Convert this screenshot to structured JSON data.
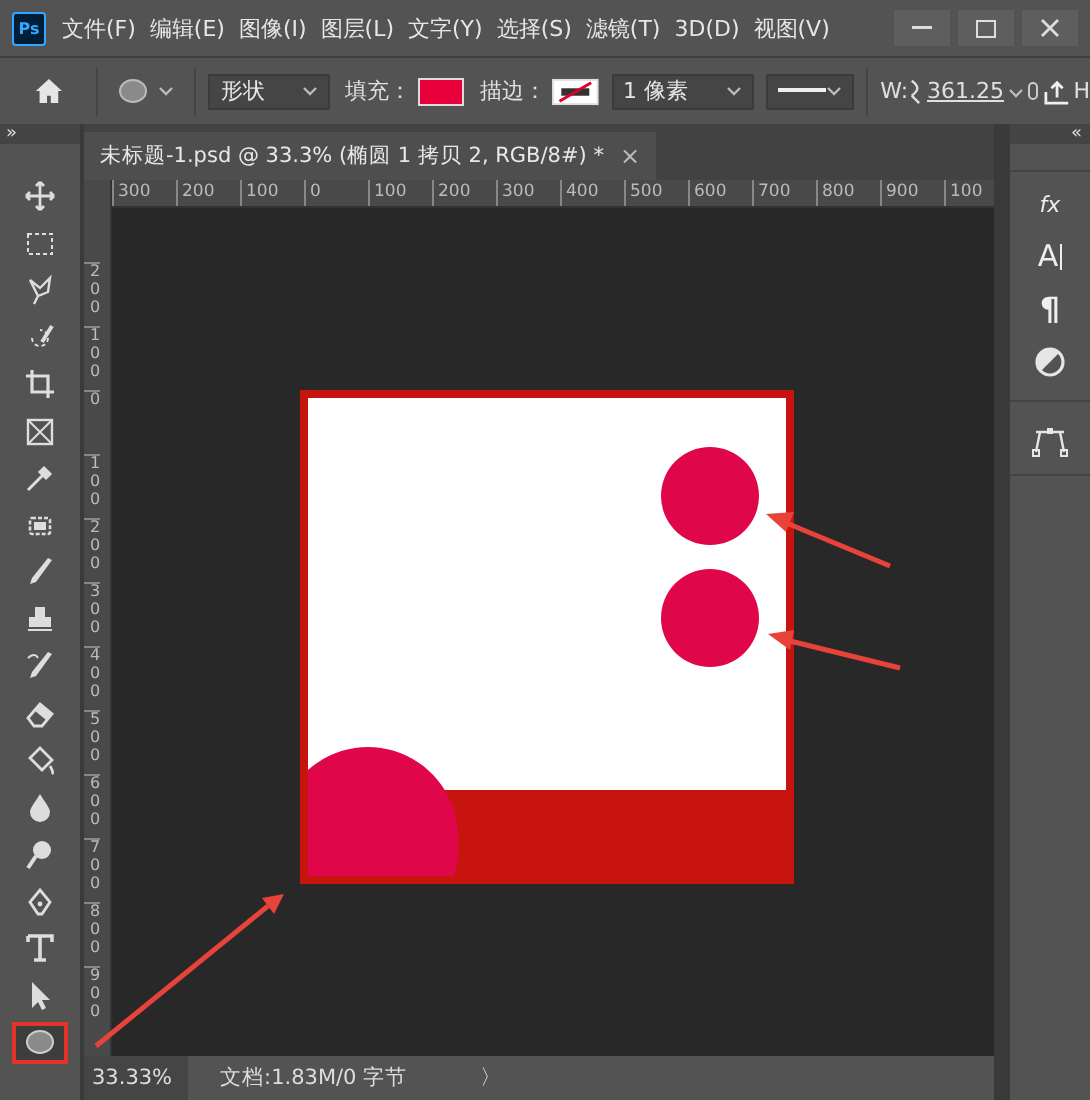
{
  "app_logo": "Ps",
  "menu": [
    "文件(F)",
    "编辑(E)",
    "图像(I)",
    "图层(L)",
    "文字(Y)",
    "选择(S)",
    "滤镜(T)",
    "3D(D)",
    "视图(V)"
  ],
  "options_bar": {
    "shape_mode": "形状",
    "fill_label": "填充：",
    "stroke_label": "描边：",
    "stroke_width": "1 像素",
    "width_label": "W:",
    "width_value": "361.25",
    "height_label": "H"
  },
  "left_panel_toggle": "»",
  "right_panel_toggle": "«",
  "document_tab": {
    "title": "未标题-1.psd @ 33.3% (椭圆 1 拷贝 2, RGB/8#) *",
    "close": "×"
  },
  "ruler_horizontal": [
    "300",
    "200",
    "100",
    "0",
    "100",
    "200",
    "300",
    "400",
    "500",
    "600",
    "700",
    "800",
    "900",
    "100"
  ],
  "ruler_vertical": [
    "200",
    "100",
    "0",
    "100",
    "200",
    "300",
    "400",
    "500",
    "600",
    "700",
    "800",
    "900"
  ],
  "tools": [
    {
      "kind": "move",
      "selected": false
    },
    {
      "kind": "marquee",
      "selected": false
    },
    {
      "kind": "lasso",
      "selected": false
    },
    {
      "kind": "quick-select",
      "selected": false
    },
    {
      "kind": "crop",
      "selected": false
    },
    {
      "kind": "frame",
      "selected": false
    },
    {
      "kind": "eyedropper",
      "selected": false
    },
    {
      "kind": "patch",
      "selected": false
    },
    {
      "kind": "brush",
      "selected": false
    },
    {
      "kind": "stamp",
      "selected": false
    },
    {
      "kind": "history-brush",
      "selected": false
    },
    {
      "kind": "eraser",
      "selected": false
    },
    {
      "kind": "bucket",
      "selected": false
    },
    {
      "kind": "drop",
      "selected": false
    },
    {
      "kind": "dodge",
      "selected": false
    },
    {
      "kind": "pen",
      "selected": false
    },
    {
      "kind": "type",
      "selected": false
    },
    {
      "kind": "path-select",
      "selected": false
    },
    {
      "kind": "ellipse",
      "selected": true
    }
  ],
  "right_panel": [
    {
      "kind": "fx",
      "label": "fx"
    },
    {
      "kind": "character",
      "label": "A"
    },
    {
      "kind": "paragraph",
      "label": "¶"
    },
    {
      "kind": "adjust"
    },
    {
      "kind": "paths"
    }
  ],
  "status_bar": {
    "zoom": "33.33%",
    "doc_info": "文档:1.83M/0 字节",
    "more": "〉"
  }
}
